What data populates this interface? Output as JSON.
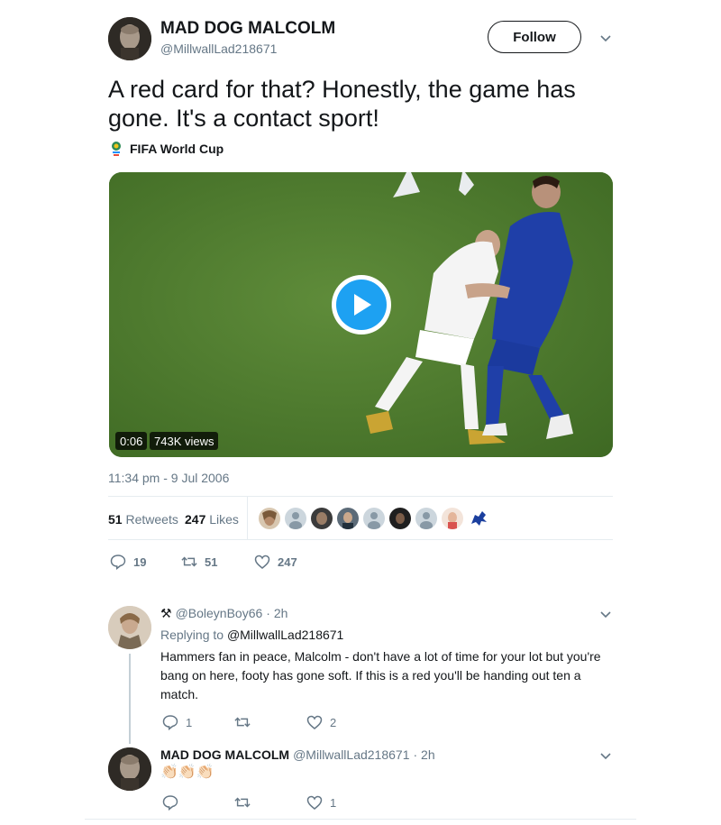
{
  "tweet": {
    "author_name": "MAD DOG MALCOLM",
    "author_handle": "@MillwallLad218671",
    "follow_label": "Follow",
    "text": "A red card for that? Honestly, the game has gone. It's a contact sport!",
    "topic_label": "FIFA World Cup",
    "video_time": "0:06",
    "video_views": "743K views",
    "timestamp": "11:34 pm - 9 Jul 2006",
    "retweets_count": "51",
    "retweets_label": "Retweets",
    "likes_count": "247",
    "likes_label": "Likes",
    "actions": {
      "replies": "19",
      "retweets": "51",
      "likes": "247"
    }
  },
  "replies": [
    {
      "badge": "⚒",
      "handle": "@BoleynBoy66",
      "time": "· 2h",
      "replying_prefix": "Replying to",
      "replying_to": "@MillwallLad218671",
      "text": "Hammers fan in peace, Malcolm - don't have a lot of time for your lot but you're bang on here, footy has gone soft. If this is a red you'll be handing out ten a match.",
      "actions": {
        "replies": "1",
        "retweets": "",
        "likes": "2"
      }
    },
    {
      "author_name": "MAD DOG MALCOLM",
      "handle": "@MillwallLad218671",
      "time": "· 2h",
      "text": "👏🏻👏🏻👏🏻",
      "actions": {
        "replies": "",
        "retweets": "",
        "likes": "1"
      }
    }
  ],
  "colors": {
    "accent": "#1da1f2",
    "secondary_text": "#657786",
    "divider": "#e6ecf0"
  }
}
